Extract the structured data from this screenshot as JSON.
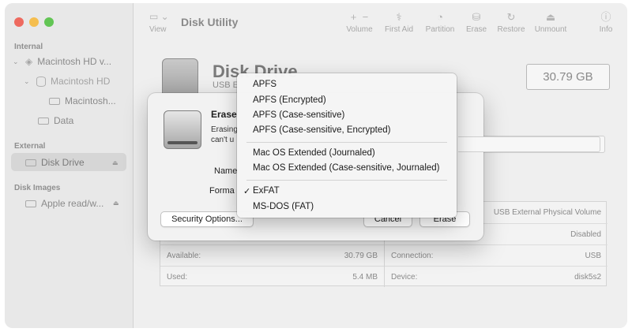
{
  "sidebar": {
    "sections": {
      "internal": "Internal",
      "external": "External",
      "disk_images": "Disk Images"
    },
    "items": {
      "macintosh_hd_container": "Macintosh HD v...",
      "macintosh_hd_volume": "Macintosh HD",
      "macintosh_snapshot": "Macintosh...",
      "data": "Data",
      "disk_drive": "Disk Drive",
      "apple_read": "Apple read/w..."
    }
  },
  "toolbar": {
    "view_label": "View",
    "title": "Disk Utility",
    "volume_label": "Volume",
    "first_aid_label": "First Aid",
    "partition_label": "Partition",
    "erase_label": "Erase",
    "restore_label": "Restore",
    "unmount_label": "Unmount",
    "info_label": "Info",
    "volume_plus": "+",
    "volume_minus": "−"
  },
  "drive": {
    "title": "Disk Drive",
    "subtitle": "USB E",
    "size": "30.79 GB"
  },
  "info_table": {
    "rows_left": [
      {
        "label": "",
        "value": ""
      },
      {
        "label": "",
        "value": ""
      },
      {
        "label": "Available:",
        "value": "30.79 GB"
      },
      {
        "label": "Used:",
        "value": "5.4 MB"
      }
    ],
    "rows_right": [
      {
        "label": "",
        "value": "USB External Physical Volume"
      },
      {
        "label": "",
        "value": "Disabled"
      },
      {
        "label": "Connection:",
        "value": "USB"
      },
      {
        "label": "Device:",
        "value": "disk5s2"
      }
    ]
  },
  "erase_sheet": {
    "title": "Erase",
    "desc_line1": "Erasing",
    "desc_line2": "can't u",
    "name_label": "Name",
    "format_label": "Forma",
    "security_options_label": "Security Options...",
    "cancel_label": "Cancel",
    "erase_label": "Erase"
  },
  "format_menu": {
    "groups": [
      [
        "APFS",
        "APFS (Encrypted)",
        "APFS (Case-sensitive)",
        "APFS (Case-sensitive, Encrypted)"
      ],
      [
        "Mac OS Extended (Journaled)",
        "Mac OS Extended (Case-sensitive, Journaled)"
      ],
      [
        "ExFAT",
        "MS-DOS (FAT)"
      ]
    ],
    "selected": "ExFAT",
    "check_glyph": "✓"
  }
}
